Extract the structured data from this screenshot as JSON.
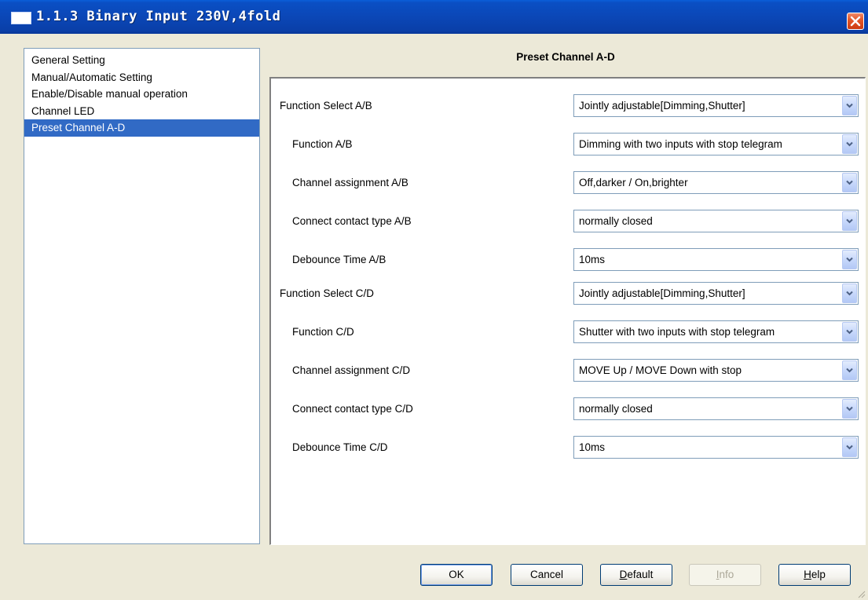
{
  "window": {
    "title": "1.1.3 Binary Input 230V,4fold",
    "title_icon": "window-icon",
    "close_icon": "close-icon"
  },
  "nav": {
    "items": [
      {
        "label": "General Setting",
        "selected": false
      },
      {
        "label": "Manual/Automatic Setting",
        "selected": false
      },
      {
        "label": "Enable/Disable manual operation",
        "selected": false
      },
      {
        "label": "Channel LED",
        "selected": false
      },
      {
        "label": "Preset Channel A-D",
        "selected": true
      }
    ]
  },
  "panel": {
    "heading": "Preset Channel A-D",
    "rows": [
      {
        "label": "Function Select A/B",
        "value": "Jointly adjustable[Dimming,Shutter]",
        "indent": false
      },
      {
        "label": "Function A/B",
        "value": "Dimming with two inputs with stop telegram",
        "indent": true
      },
      {
        "label": "Channel assignment A/B",
        "value": "Off,darker / On,brighter",
        "indent": true
      },
      {
        "label": "Connect contact type A/B",
        "value": "normally closed",
        "indent": true
      },
      {
        "label": "Debounce Time A/B",
        "value": "10ms",
        "indent": true
      },
      {
        "label": "Function Select C/D",
        "value": "Jointly adjustable[Dimming,Shutter]",
        "indent": false
      },
      {
        "label": "Function C/D",
        "value": "Shutter with two inputs with stop telegram",
        "indent": true
      },
      {
        "label": "Channel assignment C/D",
        "value": "MOVE Up / MOVE Down with stop",
        "indent": true
      },
      {
        "label": "Connect contact type C/D",
        "value": "normally closed",
        "indent": true
      },
      {
        "label": "Debounce Time C/D",
        "value": "10ms",
        "indent": true
      }
    ],
    "dropdown_icon": "chevron-down-icon"
  },
  "buttons": {
    "ok": {
      "pre": "OK",
      "u": "",
      "post": ""
    },
    "cancel": {
      "pre": "Cancel",
      "u": "",
      "post": ""
    },
    "default": {
      "pre": "",
      "u": "D",
      "post": "efault"
    },
    "info": {
      "pre": "",
      "u": "I",
      "post": "nfo",
      "disabled": true
    },
    "help": {
      "pre": "",
      "u": "H",
      "post": "elp"
    }
  },
  "colors": {
    "title_bar": "#0b47b7",
    "selection": "#316ac5",
    "dialog_bg": "#ece9d8"
  }
}
